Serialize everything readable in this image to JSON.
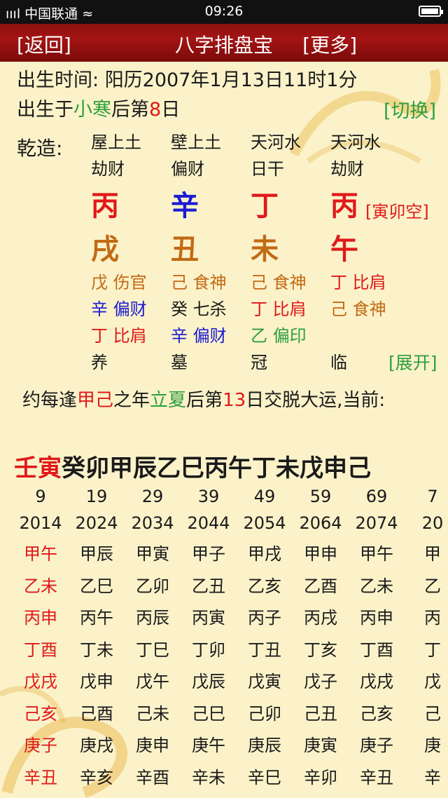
{
  "status": {
    "carrier": "ıııl 中国联通 ≈",
    "time": "09:26"
  },
  "titlebar": {
    "back": "[返回]",
    "title": "八字排盘宝",
    "more": "[更多]"
  },
  "birth": {
    "label": "出生时间: ",
    "value": "阳历2007年1月13日11时1分"
  },
  "jieqi": {
    "prefix": "出生于",
    "term": "小寒",
    "mid": "后第",
    "day": "8",
    "suffix": "日",
    "switch": "[切换]"
  },
  "qianzao": "乾造:",
  "pillars": [
    {
      "nayin": "屋上土",
      "god": "劫财",
      "stem": "丙",
      "stem_color": "#e0191a",
      "branch": "戌",
      "branch_color": "#c26a14",
      "hidden": [
        {
          "stem": "戊",
          "god": "伤官",
          "color": "#c26a14"
        },
        {
          "stem": "辛",
          "god": "偏财",
          "color": "#1b1bd4"
        },
        {
          "stem": "丁",
          "god": "比肩",
          "color": "#e0191a"
        }
      ],
      "phase": "养"
    },
    {
      "nayin": "壁上土",
      "god": "偏财",
      "stem": "辛",
      "stem_color": "#1b1bd4",
      "branch": "丑",
      "branch_color": "#c26a14",
      "hidden": [
        {
          "stem": "己",
          "god": "食神",
          "color": "#c26a14"
        },
        {
          "stem": "癸",
          "god": "七杀",
          "color": "#1a1a1a"
        },
        {
          "stem": "辛",
          "god": "偏财",
          "color": "#1b1bd4"
        }
      ],
      "phase": "墓"
    },
    {
      "nayin": "天河水",
      "god": "日干",
      "stem": "丁",
      "stem_color": "#e0191a",
      "branch": "未",
      "branch_color": "#c26a14",
      "hidden": [
        {
          "stem": "己",
          "god": "食神",
          "color": "#c26a14"
        },
        {
          "stem": "丁",
          "god": "比肩",
          "color": "#e0191a"
        },
        {
          "stem": "乙",
          "god": "偏印",
          "color": "#2c9f3d"
        }
      ],
      "phase": "冠"
    },
    {
      "nayin": "天河水",
      "god": "劫财",
      "stem": "丙",
      "stem_color": "#e0191a",
      "branch": "午",
      "branch_color": "#e0191a",
      "hidden": [
        {
          "stem": "丁",
          "god": "比肩",
          "color": "#e0191a"
        },
        {
          "stem": "己",
          "god": "食神",
          "color": "#c26a14"
        }
      ],
      "phase": "临"
    }
  ],
  "kongwang": "[寅卯空]",
  "expand": "[展开]",
  "yun": {
    "p1": "约每逢",
    "ganzhi": "甲己",
    "p2": "之年",
    "term": "立夏",
    "p3": "后第",
    "day": "13",
    "p4": "日交脱大运,当前:"
  },
  "dayun": {
    "current": "壬寅",
    "rest": "癸卯甲辰乙巳丙午丁未戊申己"
  },
  "ages": [
    "9",
    "19",
    "29",
    "39",
    "49",
    "59",
    "69",
    "7"
  ],
  "years": [
    "2014",
    "2024",
    "2034",
    "2044",
    "2054",
    "2064",
    "2074",
    "20"
  ],
  "liunian": [
    [
      "甲午",
      "甲辰",
      "甲寅",
      "甲子",
      "甲戌",
      "甲申",
      "甲午",
      "甲"
    ],
    [
      "乙未",
      "乙巳",
      "乙卯",
      "乙丑",
      "乙亥",
      "乙酉",
      "乙未",
      "乙"
    ],
    [
      "丙申",
      "丙午",
      "丙辰",
      "丙寅",
      "丙子",
      "丙戌",
      "丙申",
      "丙"
    ],
    [
      "丁酉",
      "丁未",
      "丁巳",
      "丁卯",
      "丁丑",
      "丁亥",
      "丁酉",
      "丁"
    ],
    [
      "戊戌",
      "戊申",
      "戊午",
      "戊辰",
      "戊寅",
      "戊子",
      "戊戌",
      "戊"
    ],
    [
      "己亥",
      "己酉",
      "己未",
      "己巳",
      "己卯",
      "己丑",
      "己亥",
      "己"
    ],
    [
      "庚子",
      "庚戌",
      "庚申",
      "庚午",
      "庚辰",
      "庚寅",
      "庚子",
      "庚"
    ],
    [
      "辛丑",
      "辛亥",
      "辛酉",
      "辛未",
      "辛巳",
      "辛卯",
      "辛丑",
      "辛"
    ]
  ],
  "colors": {
    "accent_red": "#e0191a",
    "green": "#2c9f3d",
    "blue": "#1b1bd4",
    "brown": "#c26a14",
    "title_bar": "#a41414",
    "background": "#fbf2c9"
  }
}
